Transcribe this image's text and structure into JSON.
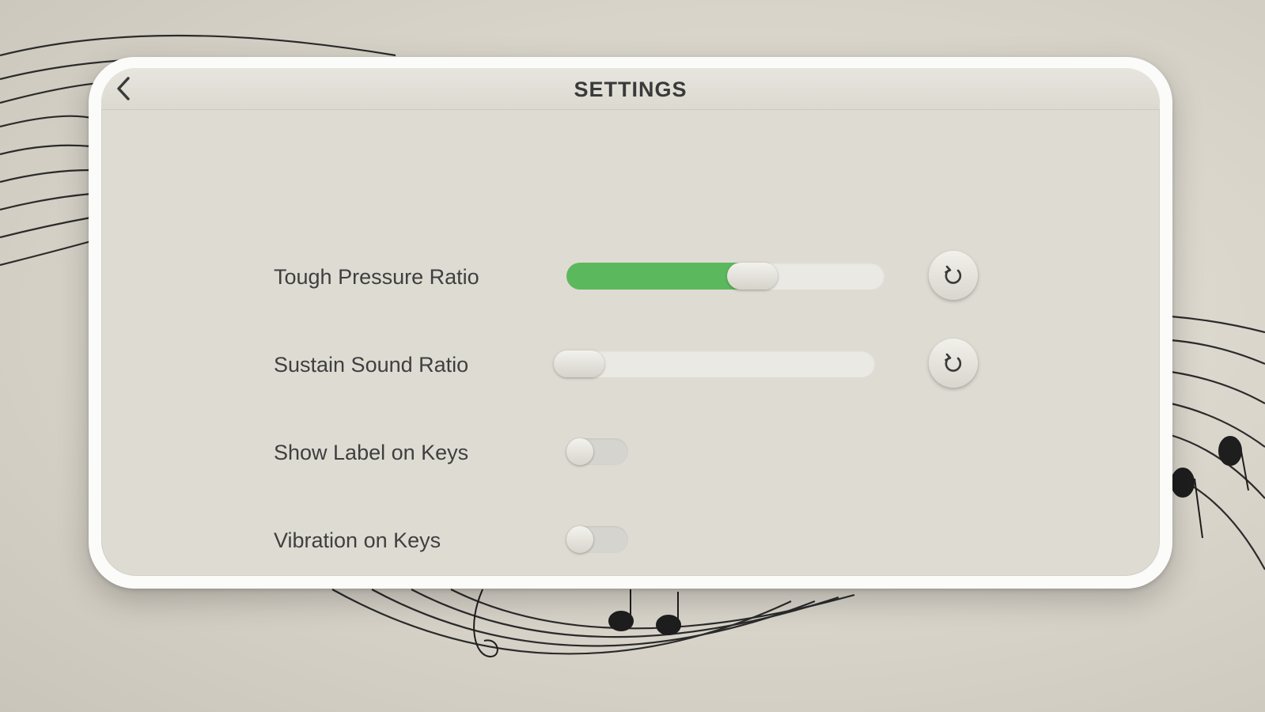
{
  "header": {
    "title": "SETTINGS",
    "back_icon": "chevron-left-icon"
  },
  "settings": [
    {
      "label": "Tough Pressure Ratio",
      "type": "slider",
      "value_fraction": 0.6,
      "reset_icon": "reset-icon"
    },
    {
      "label": "Sustain Sound Ratio",
      "type": "slider",
      "value_fraction": 0.0,
      "reset_icon": "reset-icon"
    },
    {
      "label": "Show Label on Keys",
      "type": "toggle",
      "on": false
    },
    {
      "label": "Vibration on Keys",
      "type": "toggle",
      "on": false
    }
  ],
  "colors": {
    "accent_green": "#5cb85c",
    "panel_bg": "#dedbd3",
    "panel_border": "#fbfbf9",
    "text": "#3f3f3f"
  }
}
